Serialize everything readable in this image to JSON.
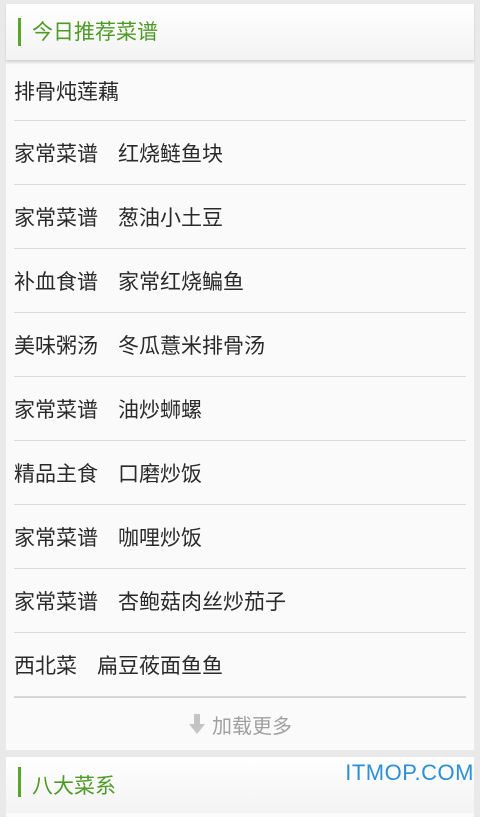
{
  "recommend": {
    "title": "今日推荐菜谱",
    "items": [
      {
        "category": "",
        "name": "排骨炖莲藕"
      },
      {
        "category": "家常菜谱",
        "name": "红烧鲢鱼块"
      },
      {
        "category": "家常菜谱",
        "name": "葱油小土豆"
      },
      {
        "category": "补血食谱",
        "name": "家常红烧鳊鱼"
      },
      {
        "category": "美味粥汤",
        "name": "冬瓜薏米排骨汤"
      },
      {
        "category": "家常菜谱",
        "name": "油炒蛳螺"
      },
      {
        "category": "精品主食",
        "name": "口磨炒饭"
      },
      {
        "category": "家常菜谱",
        "name": "咖哩炒饭"
      },
      {
        "category": "家常菜谱",
        "name": "杏鲍菇肉丝炒茄子"
      },
      {
        "category": "西北菜",
        "name": "扁豆莜面鱼鱼"
      }
    ],
    "load_more_label": "加载更多",
    "load_icon": "arrow-down-icon"
  },
  "eight_cuisines": {
    "title": "八大菜系"
  },
  "watermark": "ITMOP.COM",
  "colors": {
    "accent_green": "#5aa62b",
    "watermark_blue": "#2d8fd6"
  }
}
